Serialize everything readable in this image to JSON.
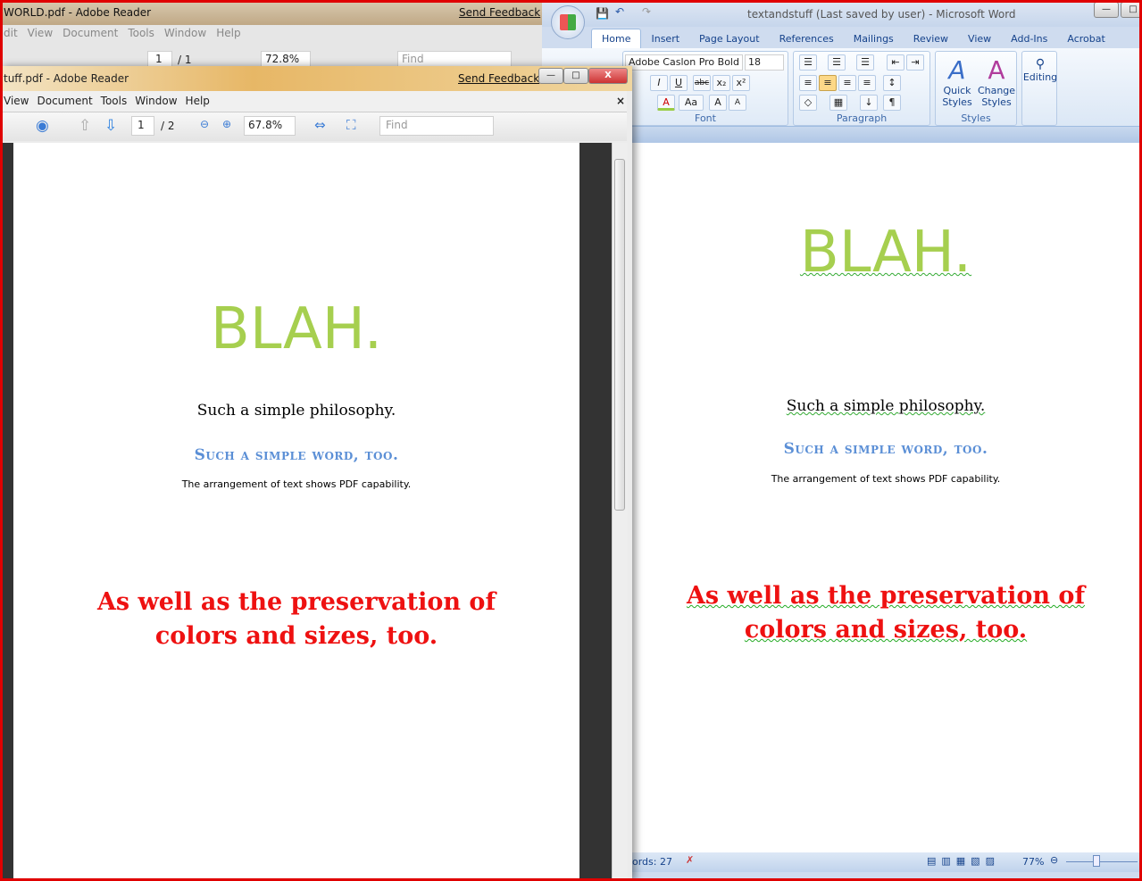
{
  "back_reader": {
    "title": "WORLD.pdf - Adobe Reader",
    "feedback": "Send Feedback",
    "menu": [
      "dit",
      "View",
      "Document",
      "Tools",
      "Window",
      "Help"
    ],
    "page": "1",
    "page_total": "/ 1",
    "zoom": "72.8%",
    "find_placeholder": "Find"
  },
  "word": {
    "title": "textandstuff (Last saved by user) - Microsoft Word",
    "tabs": [
      "Home",
      "Insert",
      "Page Layout",
      "References",
      "Mailings",
      "Review",
      "View",
      "Add-Ins",
      "Acrobat"
    ],
    "font_name": "Adobe Caslon Pro Bold",
    "font_size": "18",
    "groups": {
      "font": "Font",
      "paragraph": "Paragraph",
      "styles": "Styles"
    },
    "quick_styles": "Quick Styles",
    "change_styles": "Change Styles",
    "editing": "Editing",
    "status": {
      "words": "ords: 27",
      "zoom": "77%"
    },
    "doc": {
      "heading": "BLAH.",
      "line1": "Such a simple philosophy.",
      "line2": "Such a simple word, too.",
      "line3": "The arrangement of text shows PDF capability.",
      "line4a": "As well as the preservation of",
      "line4b": "colors and sizes, too."
    }
  },
  "front_reader": {
    "title": "tuff.pdf - Adobe Reader",
    "feedback": "Send Feedback",
    "menu": [
      "View",
      "Document",
      "Tools",
      "Window",
      "Help"
    ],
    "page": "1",
    "page_total": "/ 2",
    "zoom": "67.8%",
    "find_placeholder": "Find",
    "doc": {
      "heading": "BLAH.",
      "line1": "Such a simple philosophy.",
      "line2": "Such a simple word, too.",
      "line3": "The arrangement of text shows PDF capability.",
      "line4a": "As well as the preservation of",
      "line4b": "colors and sizes, too."
    }
  },
  "colors": {
    "heading": "#a6cf4f",
    "subheading": "#5b8fd6",
    "red_text": "#ee1111",
    "frame": "#e00000"
  }
}
